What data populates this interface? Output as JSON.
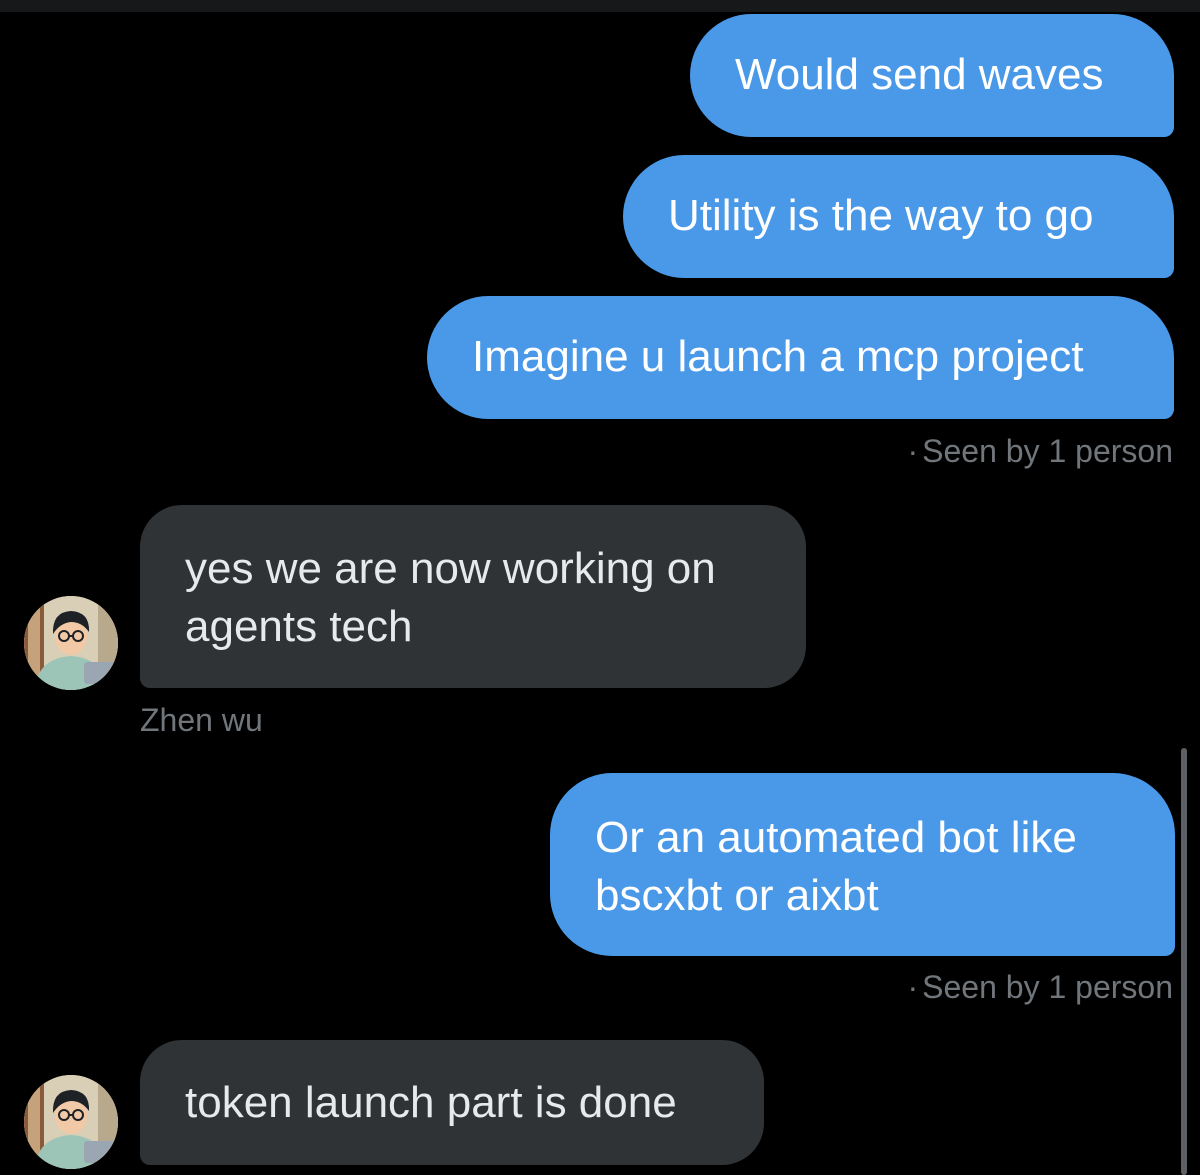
{
  "messages": [
    {
      "side": "sent",
      "text": "Would send waves"
    },
    {
      "side": "sent",
      "text": "Utility is the way to go"
    },
    {
      "side": "sent",
      "text": "Imagine u launch a mcp project"
    },
    {
      "side": "received",
      "lines": [
        "yes we are now working on",
        "agents tech"
      ],
      "sender": "Zhen wu"
    },
    {
      "side": "sent",
      "lines": [
        "Or an automated bot like",
        "bscxbt or aixbt"
      ]
    },
    {
      "side": "received",
      "text": "token launch part is done"
    }
  ],
  "receipts": {
    "seen_1": "Seen by 1 person",
    "seen_2": "Seen by 1 person",
    "separator": "·"
  },
  "avatar": {
    "icon": "person-avatar-icon"
  },
  "colors": {
    "background": "#000000",
    "sent_bubble": "#4a99e9",
    "received_bubble": "#2f3336",
    "muted_text": "#71767b"
  }
}
